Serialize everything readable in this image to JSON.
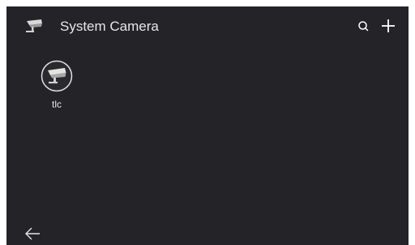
{
  "header": {
    "title": "System Camera",
    "icon": "camera-icon",
    "actions": [
      "search-icon",
      "add-icon"
    ]
  },
  "devices": [
    {
      "name": "tlc",
      "icon": "camera-icon"
    }
  ],
  "footer": {
    "back_icon": "arrow-left-icon"
  },
  "colors": {
    "background": "#242328",
    "text": "#e6e6e6",
    "icon": "#ffffff"
  }
}
